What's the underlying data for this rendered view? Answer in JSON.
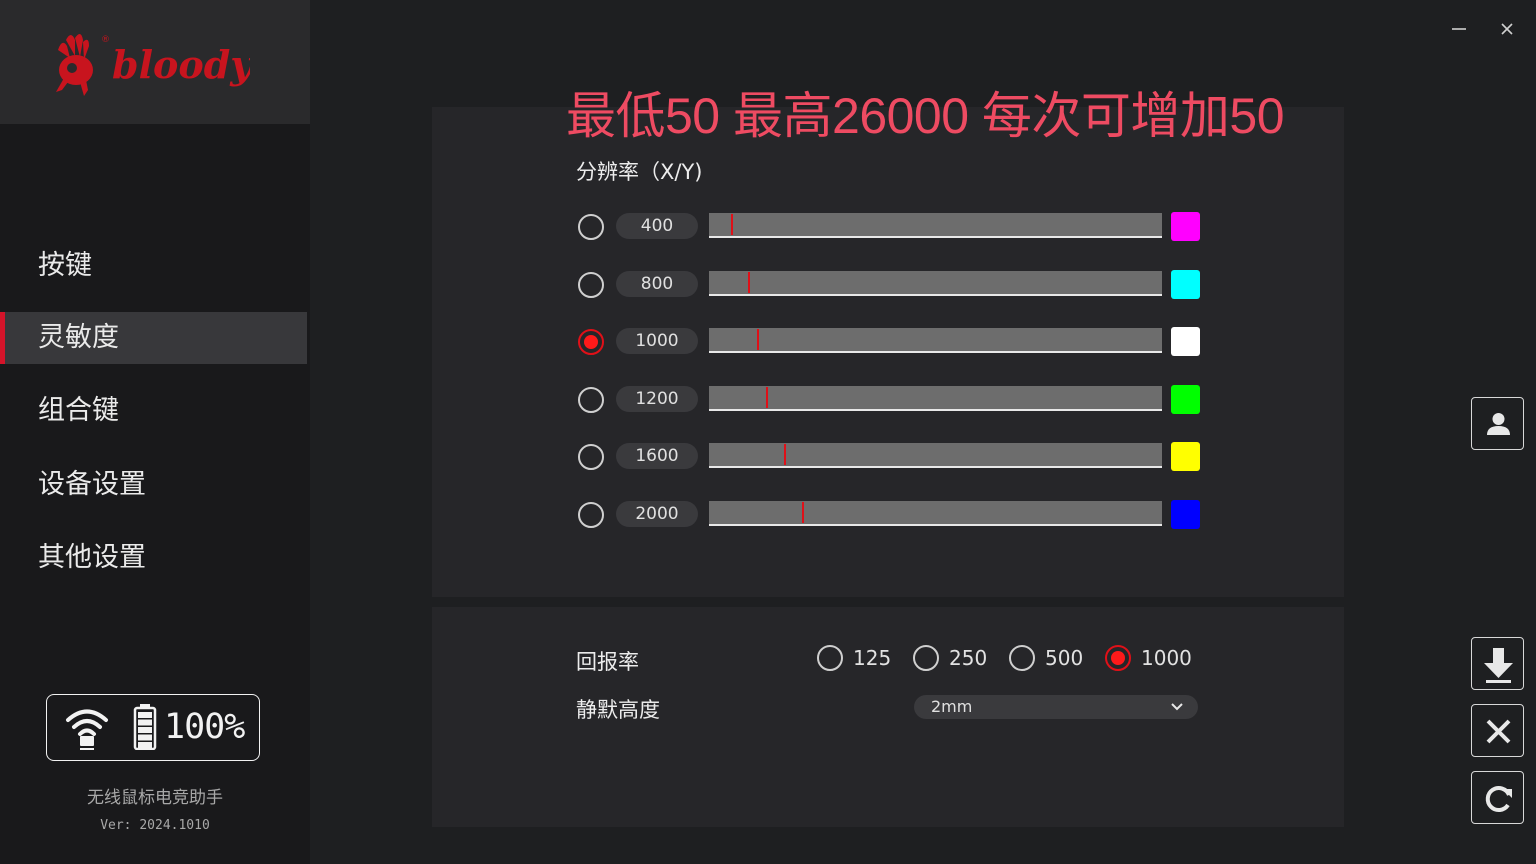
{
  "brand": {
    "logo_text": "bloody"
  },
  "window": {
    "minimize_icon": "minimize-icon",
    "close_icon": "close-icon"
  },
  "sidebar": {
    "items": [
      {
        "label": "按键",
        "active": false
      },
      {
        "label": "灵敏度",
        "active": true
      },
      {
        "label": "组合键",
        "active": false
      },
      {
        "label": "设备设置",
        "active": false
      },
      {
        "label": "其他设置",
        "active": false
      }
    ],
    "status": {
      "battery_percent": "100%",
      "battery_level": 1.0
    },
    "app_name": "无线鼠标电竞助手",
    "version": "Ver: 2024.1010"
  },
  "banner": "最低50 最高26000 每次可增加50",
  "resolution": {
    "title": "分辨率（X/Y)",
    "min": 50,
    "max": 26000,
    "levels": [
      {
        "value": "400",
        "selected": false,
        "color": "#ff00ff"
      },
      {
        "value": "800",
        "selected": false,
        "color": "#00ffff"
      },
      {
        "value": "1000",
        "selected": true,
        "color": "#ffffff"
      },
      {
        "value": "1200",
        "selected": false,
        "color": "#00ff00"
      },
      {
        "value": "1600",
        "selected": false,
        "color": "#ffff00"
      },
      {
        "value": "2000",
        "selected": false,
        "color": "#0000ff"
      }
    ]
  },
  "report_rate": {
    "label": "回报率",
    "options": [
      {
        "value": "125",
        "selected": false
      },
      {
        "value": "250",
        "selected": false
      },
      {
        "value": "500",
        "selected": false
      },
      {
        "value": "1000",
        "selected": true
      }
    ]
  },
  "lift_off": {
    "label": "静默高度",
    "value": "2mm"
  },
  "side_buttons": [
    "profile-icon",
    "download-icon",
    "close-icon",
    "reset-icon"
  ],
  "colors": {
    "accent": "#e01018",
    "banner": "#ee4b62"
  }
}
